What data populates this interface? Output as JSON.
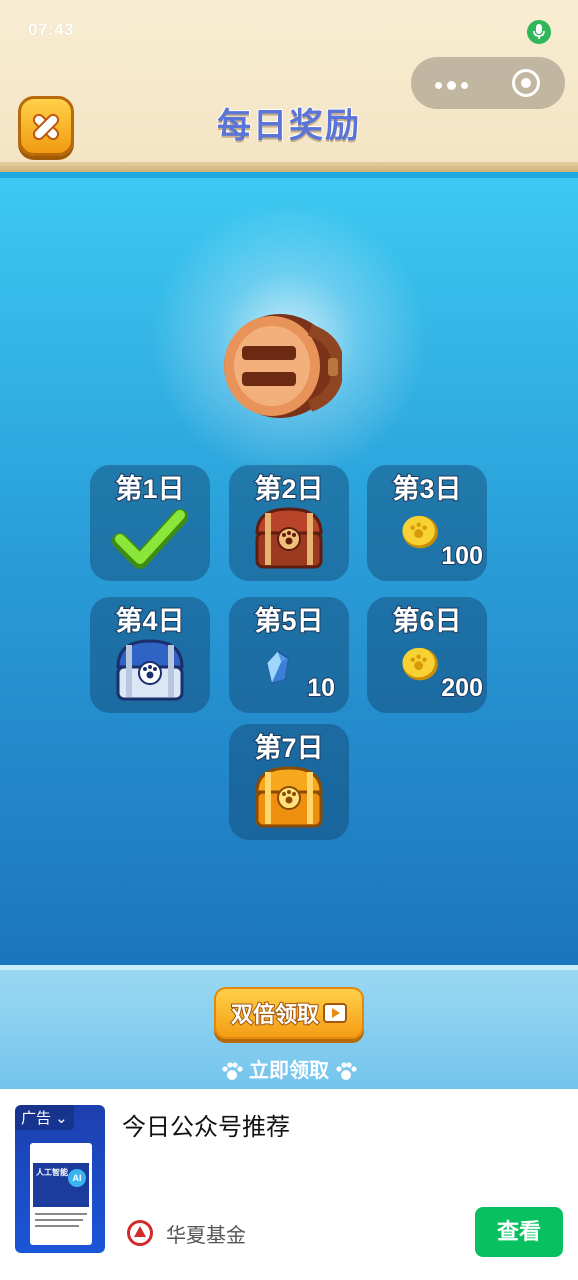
{
  "status_bar": {
    "time": "07:43",
    "mic_icon": "mic-icon"
  },
  "header": {
    "title": "每日奖励",
    "close_icon": "close-icon"
  },
  "days": [
    {
      "label": "第1日",
      "reward": "checkmark-icon",
      "amount": ""
    },
    {
      "label": "第2日",
      "reward": "brown-chest-icon",
      "amount": ""
    },
    {
      "label": "第3日",
      "reward": "paw-coin-icon",
      "amount": "100"
    },
    {
      "label": "第4日",
      "reward": "blue-chest-icon",
      "amount": ""
    },
    {
      "label": "第5日",
      "reward": "crystal-icon",
      "amount": "10"
    },
    {
      "label": "第6日",
      "reward": "paw-coin-icon",
      "amount": "200"
    },
    {
      "label": "第7日",
      "reward": "gold-chest-icon",
      "amount": ""
    }
  ],
  "actions": {
    "double_claim": "双倍领取",
    "claim_now": "立即领取"
  },
  "ad": {
    "tag": "广告",
    "thumb_text": "人工智能",
    "thumb_badge": "AI",
    "title": "今日公众号推荐",
    "source": "华夏基金",
    "button": "查看"
  },
  "colors": {
    "accent": "#f49d14",
    "panel_top": "#3cc9f2",
    "panel_bottom": "#1c75bc",
    "ad_button": "#07c160"
  }
}
